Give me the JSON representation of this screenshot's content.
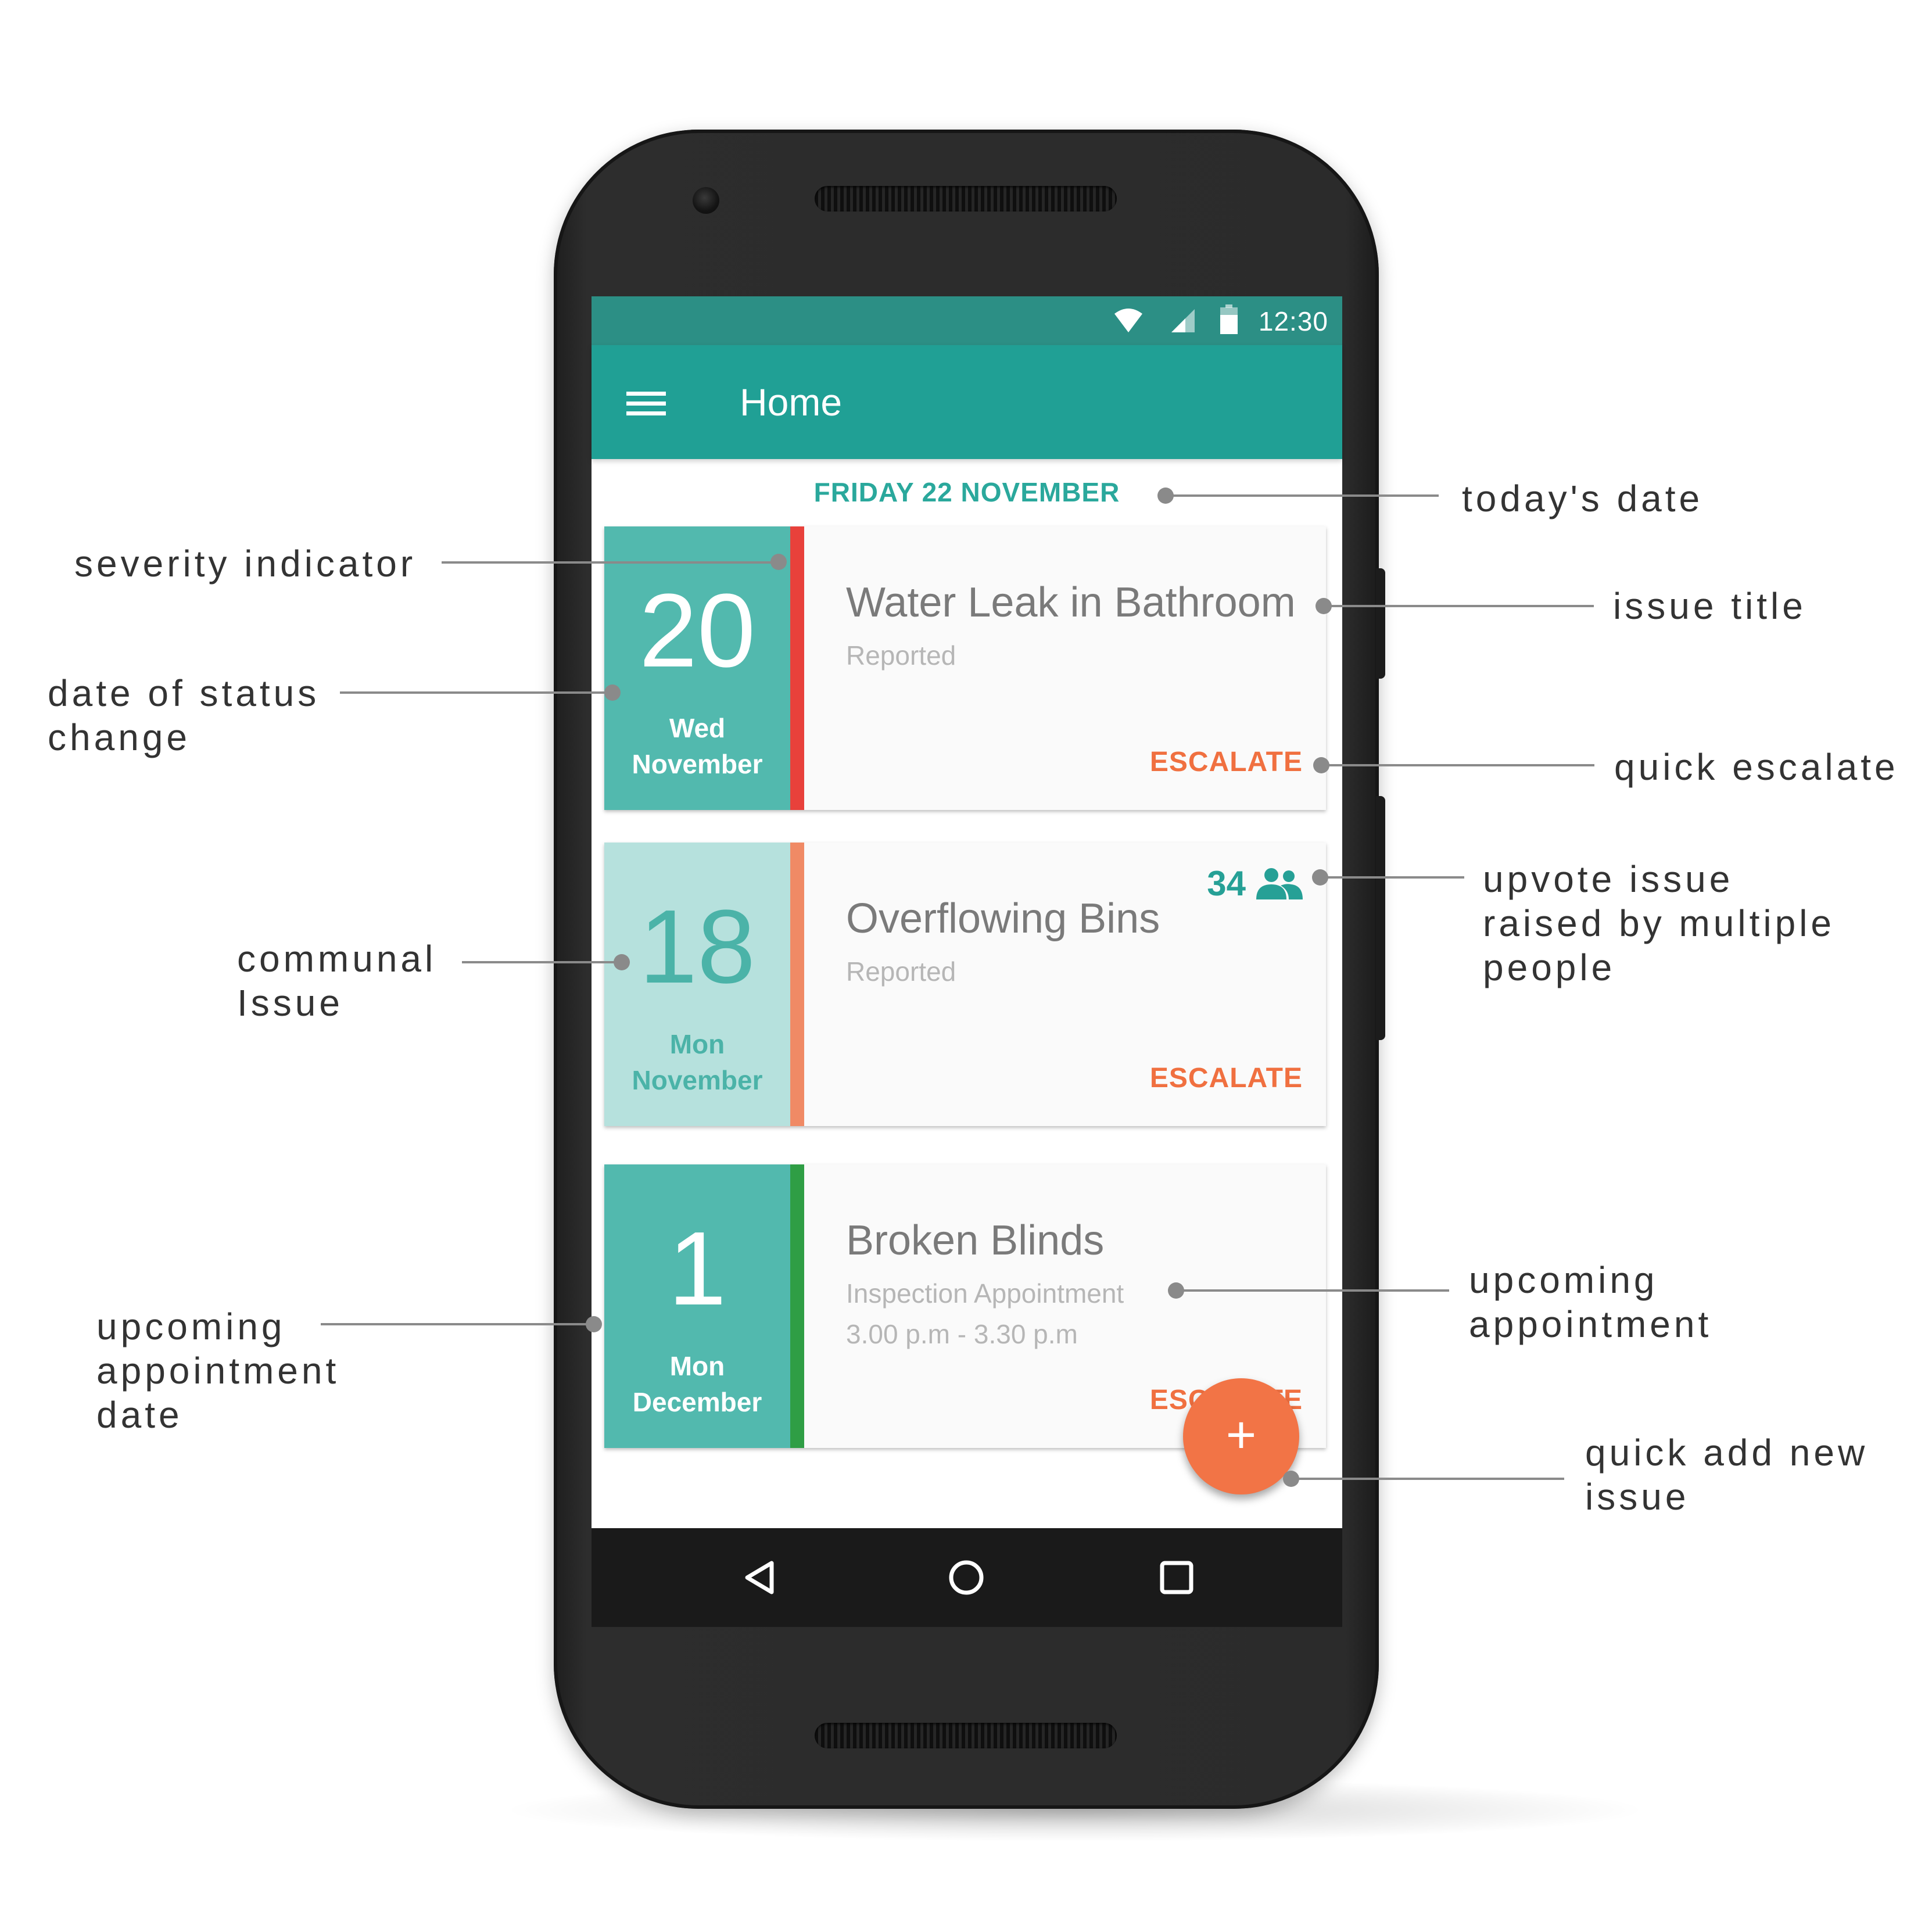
{
  "status_bar": {
    "time": "12:30",
    "icons": [
      "wifi-icon",
      "signal-icon",
      "battery-icon"
    ]
  },
  "app_bar": {
    "title": "Home",
    "menu_icon": "hamburger-menu-icon"
  },
  "today": {
    "date": "FRIDAY 22 NOVEMBER"
  },
  "issues": [
    {
      "day_num": "20",
      "weekday": "Wed",
      "month": "November",
      "title": "Water Leak in Bathroom",
      "status": "Reported",
      "action": "ESCALATE",
      "severity_color": "#e8413b",
      "date_bg": "#52b9ae",
      "date_fg": "#ffffff"
    },
    {
      "day_num": "18",
      "weekday": "Mon",
      "month": "November",
      "title": "Overflowing Bins",
      "status": "Reported",
      "action": "ESCALATE",
      "upvotes": "34",
      "upvote_icon": "people-group-icon",
      "severity_color": "#f08a65",
      "date_bg": "#b6e1dd",
      "date_fg": "#4bb3a8"
    },
    {
      "day_num": "1",
      "weekday": "Mon",
      "month": "December",
      "title": "Broken Blinds",
      "status": "Inspection Appointment",
      "time": "3.00 p.m - 3.30 p.m",
      "action": "ESCALATE",
      "severity_color": "#2f9e45",
      "date_bg": "#52b9ae",
      "date_fg": "#ffffff"
    }
  ],
  "fab": {
    "label": "+",
    "icon": "plus-icon"
  },
  "nav_bar": {
    "icons": [
      "back-triangle-icon",
      "home-circle-icon",
      "recents-square-icon"
    ]
  },
  "callouts": {
    "todays_date": "today's date",
    "severity_indicator": "severity indicator",
    "issue_title": "issue title",
    "date_of_status_change": [
      "date of status",
      "change"
    ],
    "quick_escalate": "quick escalate",
    "upvote_issue": [
      "upvote issue",
      "raised by multiple",
      "people"
    ],
    "communal_issue": [
      "communal",
      "Issue"
    ],
    "upcoming_appointment": [
      "upcoming",
      "appointment"
    ],
    "upcoming_appointment_date": [
      "upcoming",
      "appointment",
      "date"
    ],
    "quick_add": [
      "quick add new",
      "issue"
    ]
  },
  "colors": {
    "primary": "#20a095",
    "primary_dark": "#2c8f85",
    "accent": "#f27446"
  }
}
